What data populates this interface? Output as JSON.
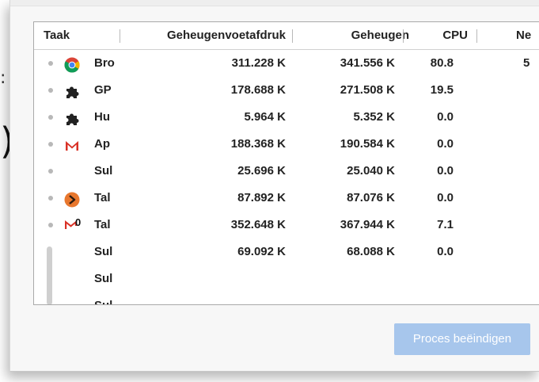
{
  "background": {
    "dots": ":",
    "paren": ")"
  },
  "task_manager": {
    "columns": {
      "task": "Taak",
      "memory_footprint": "Geheugenvoetafdruk",
      "memory": "Geheugen",
      "cpu": "CPU",
      "network": "Ne"
    },
    "rows": [
      {
        "icon": "chrome-icon",
        "title": "Bro",
        "footprint": "311.228 K",
        "memory": "341.556 K",
        "cpu": "80.8",
        "network": "5"
      },
      {
        "icon": "puzzle-extension-icon",
        "title": "GP",
        "footprint": "178.688 K",
        "memory": "271.508 K",
        "cpu": "19.5",
        "network": ""
      },
      {
        "icon": "puzzle-extension-icon",
        "title": "Hu",
        "footprint": "5.964 K",
        "memory": "5.352 K",
        "cpu": "0.0",
        "network": ""
      },
      {
        "icon": "gmail-icon",
        "title": "Ap",
        "footprint": "188.368 K",
        "memory": "190.584 K",
        "cpu": "0.0",
        "network": ""
      },
      {
        "icon": "",
        "title": "Sul",
        "footprint": "25.696 K",
        "memory": "25.040 K",
        "cpu": "0.0",
        "network": ""
      },
      {
        "icon": "orange-sigma-icon",
        "title": "Tal",
        "footprint": "87.892 K",
        "memory": "87.076 K",
        "cpu": "0.0",
        "network": ""
      },
      {
        "icon": "gmail-badge-icon",
        "title": "Tal",
        "footprint": "352.648 K",
        "memory": "367.944 K",
        "cpu": "7.1",
        "network": ""
      },
      {
        "icon": "",
        "title": "Sul",
        "footprint": "69.092 K",
        "memory": "68.088 K",
        "cpu": "0.0",
        "network": ""
      },
      {
        "icon": "",
        "title": "Sul",
        "footprint": "",
        "memory": "",
        "cpu": "",
        "network": ""
      },
      {
        "icon": "",
        "title": "Sul",
        "footprint": "",
        "memory": "",
        "cpu": "",
        "network": ""
      }
    ],
    "end_process_label": "Proces beëindigen",
    "badge_count": "0"
  },
  "colors": {
    "button_bg": "#a7c6ec",
    "gmail_red": "#d93025",
    "chrome_red": "#db4437",
    "chrome_yellow": "#f4b400",
    "chrome_green": "#0f9d58",
    "chrome_blue": "#4285f4",
    "sigma_orange": "#e8772e"
  }
}
